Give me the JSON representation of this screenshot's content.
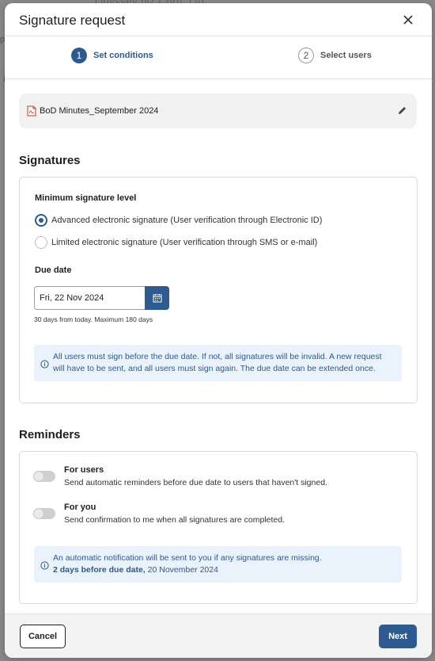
{
  "backdrop": {
    "company_text": "Odyssey biz Corp. Ltd",
    "left_a": "p",
    "left_b": "D"
  },
  "header": {
    "title": "Signature request",
    "close_icon": "close-icon"
  },
  "stepper": {
    "steps": [
      {
        "number": "1",
        "label": "Set conditions",
        "active": true
      },
      {
        "number": "2",
        "label": "Select users",
        "active": false
      }
    ]
  },
  "file": {
    "name": "BoD Minutes_September 2024",
    "icon": "pdf-file-icon",
    "edit_icon": "pencil-icon"
  },
  "signatures": {
    "title": "Signatures",
    "min_level_label": "Minimum signature level",
    "options": [
      {
        "label": "Advanced electronic signature (User verification through Electronic ID)",
        "checked": true
      },
      {
        "label": "Limited electronic signature (User verification through SMS or e-mail)",
        "checked": false
      }
    ],
    "due_date_label": "Due date",
    "due_date_value": "Fri, 22 Nov 2024",
    "due_date_hint": "30 days from today. Maximum 180 days",
    "info": "All users must sign before the due date. If not, all signatures will be invalid. A new request will have to be sent, and all users must sign again. The due date can be extended once."
  },
  "reminders": {
    "title": "Reminders",
    "items": [
      {
        "title": "For users",
        "description": "Send automatic reminders before due date to users that haven't signed.",
        "enabled": false
      },
      {
        "title": "For you",
        "description": "Send confirmation to me when all signatures are completed.",
        "enabled": false
      }
    ],
    "info_line1": "An automatic notification will be sent to you if any signatures are missing.",
    "info_strong": "2 days before due date,",
    "info_date": " 20 November 2024"
  },
  "footer": {
    "cancel_label": "Cancel",
    "next_label": "Next"
  },
  "colors": {
    "primary": "#2d5a91",
    "info_bg": "#eaf2fc",
    "card_bg": "#f1f1f1",
    "pdf_red": "#c8372d"
  }
}
